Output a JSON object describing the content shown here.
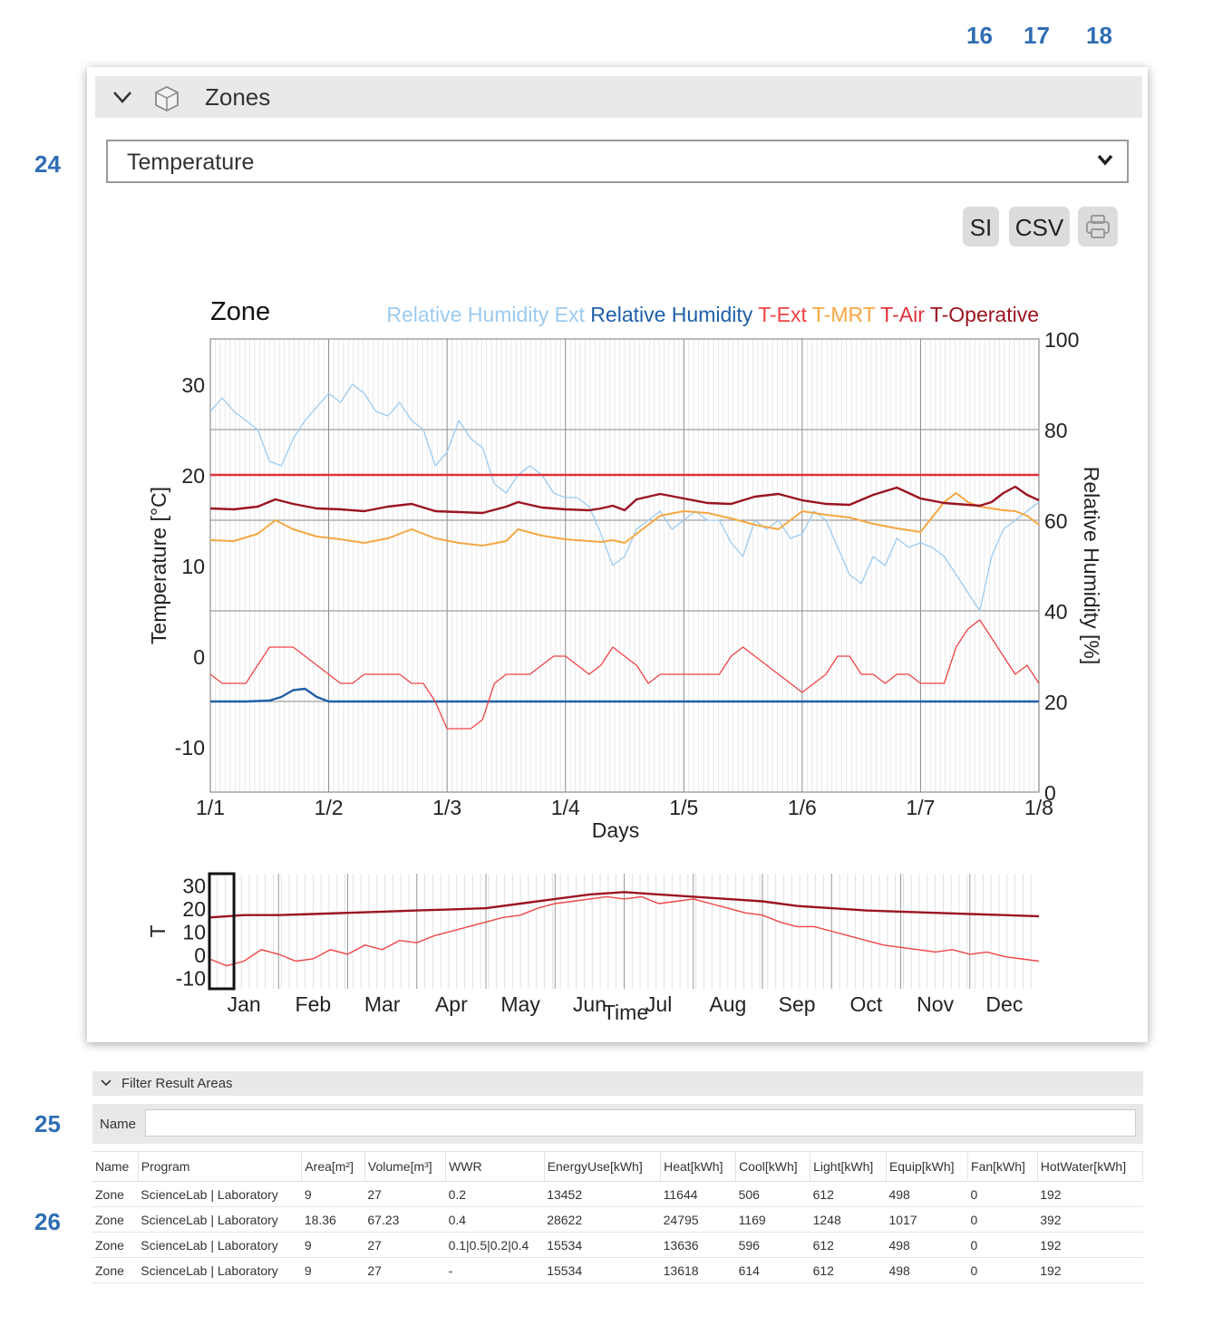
{
  "callouts": {
    "si": "16",
    "csv": "17",
    "print": "18",
    "variable": "24",
    "filter": "25",
    "table": "26"
  },
  "zones_panel": {
    "title": "Zones",
    "selected_variable": "Temperature",
    "buttons": {
      "si": "SI",
      "csv": "CSV"
    },
    "icons": [
      "chevron-down-icon",
      "cube-icon",
      "select-caret-icon",
      "printer-icon"
    ]
  },
  "chart_data": [
    {
      "type": "line",
      "title": "Zone",
      "xlabel": "Days",
      "ylabel": "Temperature [°C]",
      "y2label": "Relative Humidity [%]",
      "x_ticks": [
        "1/1",
        "1/2",
        "1/3",
        "1/4",
        "1/5",
        "1/6",
        "1/7",
        "1/8"
      ],
      "xlim": [
        0,
        7
      ],
      "ylim": [
        -15,
        35
      ],
      "y_ticks": [
        -10,
        0,
        10,
        20,
        30
      ],
      "y2lim": [
        0,
        100
      ],
      "y2_ticks": [
        0,
        20,
        40,
        60,
        80,
        100
      ],
      "grid": true,
      "legend": "top",
      "series": [
        {
          "name": "Relative Humidity Ext",
          "axis": "right",
          "color": "#9ccbf0",
          "x": [
            0,
            0.1,
            0.2,
            0.3,
            0.4,
            0.5,
            0.6,
            0.7,
            0.8,
            0.9,
            1.0,
            1.1,
            1.2,
            1.3,
            1.4,
            1.5,
            1.6,
            1.7,
            1.8,
            1.9,
            2.0,
            2.1,
            2.2,
            2.3,
            2.4,
            2.5,
            2.6,
            2.7,
            2.8,
            2.9,
            3.0,
            3.1,
            3.2,
            3.3,
            3.4,
            3.5,
            3.6,
            3.7,
            3.8,
            3.9,
            4.0,
            4.1,
            4.2,
            4.3,
            4.4,
            4.5,
            4.6,
            4.7,
            4.8,
            4.9,
            5.0,
            5.1,
            5.2,
            5.3,
            5.4,
            5.5,
            5.6,
            5.7,
            5.8,
            5.9,
            6.0,
            6.1,
            6.2,
            6.3,
            6.4,
            6.5,
            6.6,
            6.7,
            6.8,
            6.9,
            7.0
          ],
          "values": [
            84,
            87,
            84,
            82,
            80,
            73,
            72,
            78,
            82,
            85,
            88,
            86,
            90,
            88,
            84,
            83,
            86,
            82,
            80,
            72,
            75,
            82,
            78,
            76,
            68,
            66,
            70,
            72,
            70,
            66,
            65,
            65,
            63,
            57,
            50,
            52,
            58,
            60,
            62,
            58,
            60,
            62,
            60,
            60,
            55,
            52,
            60,
            58,
            60,
            56,
            57,
            62,
            60,
            54,
            48,
            46,
            52,
            50,
            56,
            54,
            55,
            54,
            52,
            48,
            44,
            40,
            52,
            58,
            60,
            62,
            64
          ]
        },
        {
          "name": "Relative Humidity",
          "axis": "right",
          "color": "#1f5fa8",
          "x": [
            0,
            0.3,
            0.5,
            0.6,
            0.7,
            0.8,
            0.9,
            1.0,
            1.5,
            2.0,
            3.0,
            4.0,
            5.0,
            6.0,
            7.0
          ],
          "values": [
            20,
            20,
            20.2,
            21,
            22.5,
            22.8,
            21,
            20,
            20,
            20,
            20,
            20,
            20,
            20,
            20
          ]
        },
        {
          "name": "T-Ext",
          "axis": "left",
          "color": "#ef4444",
          "x": [
            0,
            0.1,
            0.3,
            0.4,
            0.5,
            0.6,
            0.7,
            0.8,
            0.9,
            1.0,
            1.1,
            1.2,
            1.3,
            1.4,
            1.5,
            1.6,
            1.7,
            1.8,
            1.9,
            2.0,
            2.1,
            2.2,
            2.3,
            2.4,
            2.5,
            2.6,
            2.7,
            2.8,
            2.9,
            3.0,
            3.1,
            3.2,
            3.3,
            3.4,
            3.5,
            3.6,
            3.7,
            3.8,
            3.9,
            4.0,
            4.1,
            4.2,
            4.3,
            4.4,
            4.5,
            4.6,
            4.7,
            4.8,
            4.9,
            5.0,
            5.1,
            5.2,
            5.3,
            5.4,
            5.5,
            5.6,
            5.7,
            5.8,
            5.9,
            6.0,
            6.1,
            6.2,
            6.3,
            6.4,
            6.5,
            6.6,
            6.7,
            6.8,
            6.9,
            7.0
          ],
          "values": [
            -2,
            -3,
            -3,
            -1,
            1,
            1,
            1,
            0,
            -1,
            -2,
            -3,
            -3,
            -2,
            -2,
            -2,
            -2,
            -3,
            -3,
            -5,
            -8,
            -8,
            -8,
            -7,
            -3,
            -2,
            -2,
            -2,
            -1,
            0,
            0,
            -1,
            -2,
            -1,
            1,
            0,
            -1,
            -3,
            -2,
            -2,
            -2,
            -2,
            -2,
            -2,
            0,
            1,
            0,
            -1,
            -2,
            -3,
            -4,
            -3,
            -2,
            0,
            0,
            -2,
            -2,
            -3,
            -2,
            -2,
            -3,
            -3,
            -3,
            1,
            3,
            4,
            2,
            0,
            -2,
            -1,
            -3
          ]
        },
        {
          "name": "T-MRT",
          "axis": "left",
          "color": "#f5a742",
          "x": [
            0,
            0.2,
            0.4,
            0.55,
            0.7,
            0.9,
            1.1,
            1.3,
            1.5,
            1.7,
            1.9,
            2.1,
            2.3,
            2.5,
            2.6,
            2.8,
            3.0,
            3.2,
            3.3,
            3.4,
            3.5,
            3.6,
            3.8,
            4.0,
            4.2,
            4.4,
            4.6,
            4.8,
            5.0,
            5.2,
            5.4,
            5.6,
            5.8,
            6.0,
            6.2,
            6.3,
            6.4,
            6.5,
            6.6,
            6.7,
            6.8,
            6.9,
            7.0
          ],
          "values": [
            12.8,
            12.7,
            13.5,
            15,
            14,
            13.2,
            12.9,
            12.5,
            13,
            14,
            13,
            12.5,
            12.2,
            12.7,
            14,
            13.3,
            12.9,
            12.7,
            12.6,
            12.8,
            12.5,
            13.5,
            15.5,
            16,
            15.8,
            15.2,
            14.5,
            14,
            16,
            15.6,
            15.3,
            14.6,
            14.1,
            13.7,
            17,
            18,
            17,
            16.5,
            16.3,
            16.1,
            16,
            15.5,
            14.5
          ]
        },
        {
          "name": "T-Air",
          "axis": "left",
          "color": "#e0303a",
          "x": [
            0,
            7
          ],
          "values": [
            20,
            20
          ]
        },
        {
          "name": "T-Operative",
          "axis": "left",
          "color": "#9b1420",
          "x": [
            0,
            0.2,
            0.4,
            0.55,
            0.7,
            0.9,
            1.1,
            1.3,
            1.5,
            1.7,
            1.9,
            2.1,
            2.3,
            2.5,
            2.6,
            2.8,
            3.0,
            3.2,
            3.3,
            3.4,
            3.5,
            3.6,
            3.8,
            4.0,
            4.2,
            4.4,
            4.6,
            4.8,
            5.0,
            5.2,
            5.4,
            5.6,
            5.8,
            6.0,
            6.2,
            6.3,
            6.4,
            6.5,
            6.6,
            6.7,
            6.8,
            6.9,
            7.0
          ],
          "values": [
            16.3,
            16.2,
            16.5,
            17.3,
            16.8,
            16.3,
            16.2,
            16,
            16.5,
            16.8,
            16,
            15.9,
            15.8,
            16.5,
            17,
            16.4,
            16.2,
            16.1,
            16.3,
            16.6,
            16.1,
            17.3,
            17.9,
            17.4,
            16.9,
            16.8,
            17.6,
            17.9,
            17.2,
            16.8,
            16.7,
            17.8,
            18.6,
            17.4,
            16.9,
            16.8,
            16.7,
            16.6,
            17,
            18,
            18.7,
            17.8,
            17.2
          ]
        }
      ]
    },
    {
      "type": "line",
      "title": "",
      "xlabel": "Time",
      "ylabel": "T",
      "x_ticks": [
        "Jan",
        "Feb",
        "Mar",
        "Apr",
        "May",
        "Jun",
        "Jul",
        "Aug",
        "Sep",
        "Oct",
        "Nov",
        "Dec"
      ],
      "xlim": [
        0,
        12
      ],
      "ylim": [
        -15,
        35
      ],
      "y_ticks": [
        -10,
        0,
        10,
        20,
        30
      ],
      "selection_range": [
        0,
        0.25
      ],
      "series": [
        {
          "name": "T-Ext",
          "color": "#ef4444",
          "x": [
            0,
            0.25,
            0.5,
            0.75,
            1,
            1.25,
            1.5,
            1.75,
            2,
            2.25,
            2.5,
            2.75,
            3,
            3.25,
            3.5,
            3.75,
            4,
            4.25,
            4.5,
            4.75,
            5,
            5.25,
            5.5,
            5.75,
            6,
            6.25,
            6.5,
            6.75,
            7,
            7.25,
            7.5,
            7.75,
            8,
            8.25,
            8.5,
            8.75,
            9,
            9.25,
            9.5,
            9.75,
            10,
            10.25,
            10.5,
            10.75,
            11,
            11.25,
            11.5,
            11.75,
            12
          ],
          "values": [
            -2,
            -5,
            -3,
            2,
            0,
            -3,
            -2,
            2,
            0,
            4,
            2,
            6,
            5,
            8,
            10,
            12,
            14,
            16,
            17,
            20,
            22,
            23,
            24,
            25,
            24,
            25,
            22,
            23,
            24,
            22,
            20,
            18,
            17,
            14,
            12,
            12,
            10,
            8,
            6,
            4,
            3,
            2,
            1,
            2,
            0,
            1,
            -1,
            -2,
            -3
          ]
        },
        {
          "name": "T-Operative",
          "color": "#9b1420",
          "x": [
            0,
            0.5,
            1,
            1.5,
            2,
            2.5,
            3,
            3.5,
            4,
            4.5,
            5,
            5.5,
            6,
            6.5,
            7,
            7.5,
            8,
            8.5,
            9,
            9.5,
            10,
            10.5,
            11,
            11.5,
            12
          ],
          "values": [
            16,
            17,
            17,
            17.5,
            18,
            18.5,
            19,
            19.5,
            20,
            22,
            24,
            26,
            27,
            26,
            25,
            24,
            23,
            21,
            20,
            19,
            18.5,
            18,
            17.5,
            17,
            16.5
          ]
        }
      ]
    }
  ],
  "filter": {
    "title": "Filter Result Areas",
    "name_label": "Name",
    "name_value": ""
  },
  "table": {
    "headers": [
      "Name",
      "Program",
      "Area[m²]",
      "Volume[m³]",
      "WWR",
      "EnergyUse[kWh]",
      "Heat[kWh]",
      "Cool[kWh]",
      "Light[kWh]",
      "Equip[kWh]",
      "Fan[kWh]",
      "HotWater[kWh]"
    ],
    "rows": [
      [
        "Zone",
        "ScienceLab | Laboratory",
        "9",
        "27",
        "0.2",
        "13452",
        "11644",
        "506",
        "612",
        "498",
        "0",
        "192"
      ],
      [
        "Zone",
        "ScienceLab | Laboratory",
        "18.36",
        "67.23",
        "0.4",
        "28622",
        "24795",
        "1169",
        "1248",
        "1017",
        "0",
        "392"
      ],
      [
        "Zone",
        "ScienceLab | Laboratory",
        "9",
        "27",
        "0.1|0.5|0.2|0.4",
        "15534",
        "13636",
        "596",
        "612",
        "498",
        "0",
        "192"
      ],
      [
        "Zone",
        "ScienceLab | Laboratory",
        "9",
        "27",
        "-",
        "15534",
        "13618",
        "614",
        "612",
        "498",
        "0",
        "192"
      ]
    ]
  }
}
